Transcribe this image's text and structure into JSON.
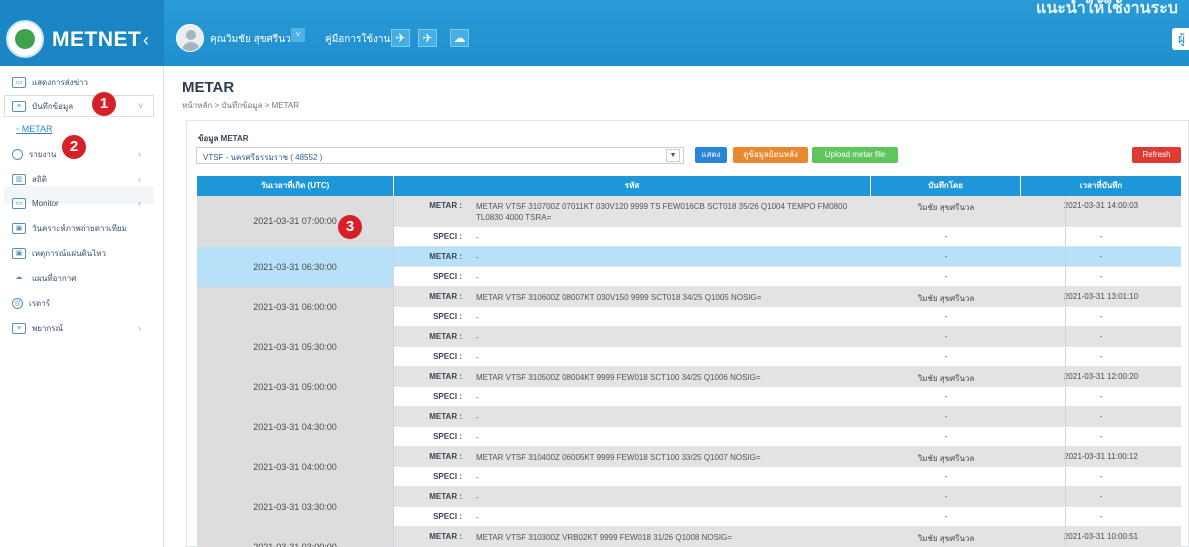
{
  "header": {
    "brand": "METNET",
    "collapse_icon": "chevron-left-icon",
    "user_name": "คุณวิมชัย สุขศรีนวล",
    "manual_label": "คู่มือการใช้งาน",
    "icons": [
      "plane-icon",
      "plane-icon",
      "cloud-icon"
    ],
    "notice": "แนะนำให้ใช้งานระบ",
    "right_button": "ผู้"
  },
  "sidebar": {
    "items": [
      {
        "label": "แสดงการส่งข่าว",
        "icon": "monitor-icon"
      },
      {
        "label": "บันทึกข้อมูล",
        "icon": "document-icon"
      },
      {
        "label": "รายงาน",
        "icon": "pie-chart-icon"
      },
      {
        "label": "สถิติ",
        "icon": "bar-chart-icon"
      },
      {
        "label": "Monitor",
        "icon": "screen-icon"
      },
      {
        "label": "วันคราะห์ภาพถ่ายดาวเทียม",
        "icon": "image-icon"
      },
      {
        "label": "เหตุการณ์แผ่นดินไหว",
        "icon": "image-icon"
      },
      {
        "label": "แผนที่อากาศ",
        "icon": "cloud-icon"
      },
      {
        "label": "เรดาร์",
        "icon": "radar-icon"
      },
      {
        "label": "พยากรณ์",
        "icon": "document-icon"
      }
    ],
    "sub_item": "METAR",
    "markers": [
      "1",
      "2",
      "3"
    ]
  },
  "main": {
    "title": "METAR",
    "breadcrumb": "หน้าหลัก  >  บันทึกข้อมูล  >  METAR",
    "field_label": "ข้อมูล METAR",
    "station": "VTSF - นครศรีธรรมราช ( 48552 )",
    "buttons": {
      "show": "แสดง",
      "past": "ดูข้อมูลย้อนหลัง",
      "upload": "Upload metar file",
      "refresh": "Refresh"
    }
  },
  "table": {
    "headers": [
      "วันเวลาที่เกิด (UTC)",
      "รหัส",
      "บันทึกโดย",
      "เวลาที่บันทึก"
    ],
    "metar_label": "METAR :",
    "speci_label": "SPECI :",
    "rows": [
      {
        "time": "2021-03-31 07:00:00",
        "metar": "METAR VTSF 310700Z 07011KT 030V120 9999 TS FEW016CB SCT018 35/26 Q1004 TEMPO FM0800 TL0830 4000 TSRA=",
        "speci": "-",
        "by": "วิมชัย สุขศรีนวล",
        "recorded": "2021-03-31 14:00:03",
        "by2": "-",
        "recorded2": "-"
      },
      {
        "time": "2021-03-31 06:30:00",
        "metar": "-",
        "speci": "-",
        "by": "-",
        "recorded": "-",
        "by2": "-",
        "recorded2": "-"
      },
      {
        "time": "2021-03-31 06:00:00",
        "metar": "METAR VTSF 310600Z 08007KT 030V150 9999 SCT018 34/25 Q1005 NOSIG=",
        "speci": "-",
        "by": "วิมชัย สุขศรีนวล",
        "recorded": "2021-03-31 13:01:10",
        "by2": "-",
        "recorded2": "-"
      },
      {
        "time": "2021-03-31 05:30:00",
        "metar": "-",
        "speci": "-",
        "by": "-",
        "recorded": "-",
        "by2": "-",
        "recorded2": "-"
      },
      {
        "time": "2021-03-31 05:00:00",
        "metar": "METAR VTSF 310500Z 08004KT 9999 FEW018 SCT100 34/25 Q1006 NOSIG=",
        "speci": "-",
        "by": "วิมชัย สุขศรีนวล",
        "recorded": "2021-03-31 12:00:20",
        "by2": "-",
        "recorded2": "-"
      },
      {
        "time": "2021-03-31 04:30:00",
        "metar": "-",
        "speci": "-",
        "by": "-",
        "recorded": "-",
        "by2": "-",
        "recorded2": "-"
      },
      {
        "time": "2021-03-31 04:00:00",
        "metar": "METAR VTSF 310400Z 06005KT 9999 FEW018 SCT100 33/25 Q1007 NOSIG=",
        "speci": "-",
        "by": "วิมชัย สุขศรีนวล",
        "recorded": "2021-03-31 11:00:12",
        "by2": "-",
        "recorded2": "-"
      },
      {
        "time": "2021-03-31 03:30:00",
        "metar": "-",
        "speci": "-",
        "by": "-",
        "recorded": "-",
        "by2": "-",
        "recorded2": "-"
      },
      {
        "time": "2021-03-31 03:00:00",
        "metar": "METAR VTSF 310300Z VRB02KT 9999 FEW018 31/26 Q1008 NOSIG=",
        "speci": "",
        "by": "วิมชัย สุขศรีนวล",
        "recorded": "2021-03-31 10:00:51",
        "by2": "",
        "recorded2": ""
      }
    ]
  }
}
